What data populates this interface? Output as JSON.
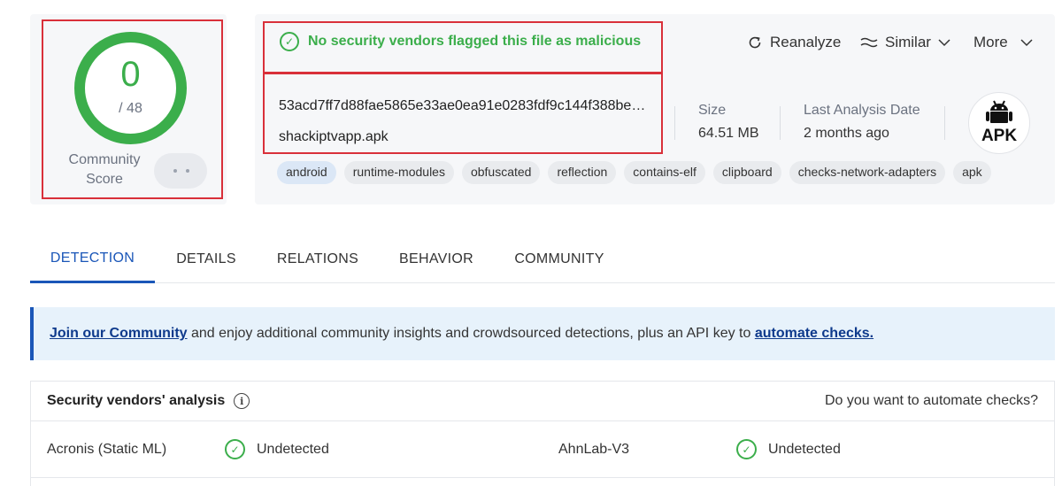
{
  "score": {
    "detections": "0",
    "total": "/ 48",
    "community_label_line1": "Community",
    "community_label_line2": "Score"
  },
  "banner": {
    "text": "No security vendors flagged this file as malicious"
  },
  "actions": {
    "reanalyze": "Reanalyze",
    "similar": "Similar",
    "more": "More"
  },
  "file": {
    "hash": "53acd7ff7d88fae5865e33ae0ea91e0283fdf9c144f388be…",
    "name": "shackiptvapp.apk",
    "size_label": "Size",
    "size_value": "64.51 MB",
    "date_label": "Last Analysis Date",
    "date_value": "2 months ago",
    "type_badge": "APK"
  },
  "tags": [
    "android",
    "runtime-modules",
    "obfuscated",
    "reflection",
    "contains-elf",
    "clipboard",
    "checks-network-adapters",
    "apk"
  ],
  "tabs": [
    "DETECTION",
    "DETAILS",
    "RELATIONS",
    "BEHAVIOR",
    "COMMUNITY"
  ],
  "join_bar": {
    "link1": "Join our Community",
    "middle": " and enjoy additional community insights and crowdsourced detections, plus an API key to ",
    "link2": "automate checks."
  },
  "vendors": {
    "title": "Security vendors' analysis",
    "automate_question": "Do you want to automate checks?",
    "rows": [
      {
        "vendor1": "Acronis (Static ML)",
        "result1": "Undetected",
        "vendor2": "AhnLab-V3",
        "result2": "Undetected"
      }
    ]
  },
  "colors": {
    "accent_green": "#3bae4b",
    "accent_blue": "#1a56b8",
    "highlight_red": "#d9303a"
  }
}
